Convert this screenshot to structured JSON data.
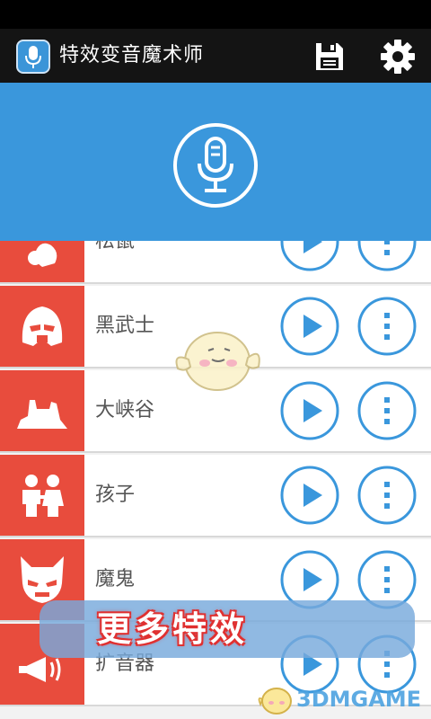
{
  "app": {
    "title": "特效变音魔术师"
  },
  "toolbar": {
    "save_icon": "save-icon",
    "settings_icon": "gear-icon"
  },
  "hero": {
    "record_icon": "microphone-icon"
  },
  "effects": [
    {
      "name": "松鼠",
      "icon": "squirrel-icon"
    },
    {
      "name": "黑武士",
      "icon": "dark-helmet-icon"
    },
    {
      "name": "大峡谷",
      "icon": "canyon-icon"
    },
    {
      "name": "孩子",
      "icon": "children-icon"
    },
    {
      "name": "魔鬼",
      "icon": "devil-icon"
    },
    {
      "name": "扩音器",
      "icon": "megaphone-icon"
    }
  ],
  "banner": {
    "text": "更多特效"
  },
  "watermark": {
    "text": "3DMGAME"
  },
  "colors": {
    "accent_blue": "#3a97dc",
    "effect_red": "#e84c3d",
    "appbar": "#141414"
  }
}
